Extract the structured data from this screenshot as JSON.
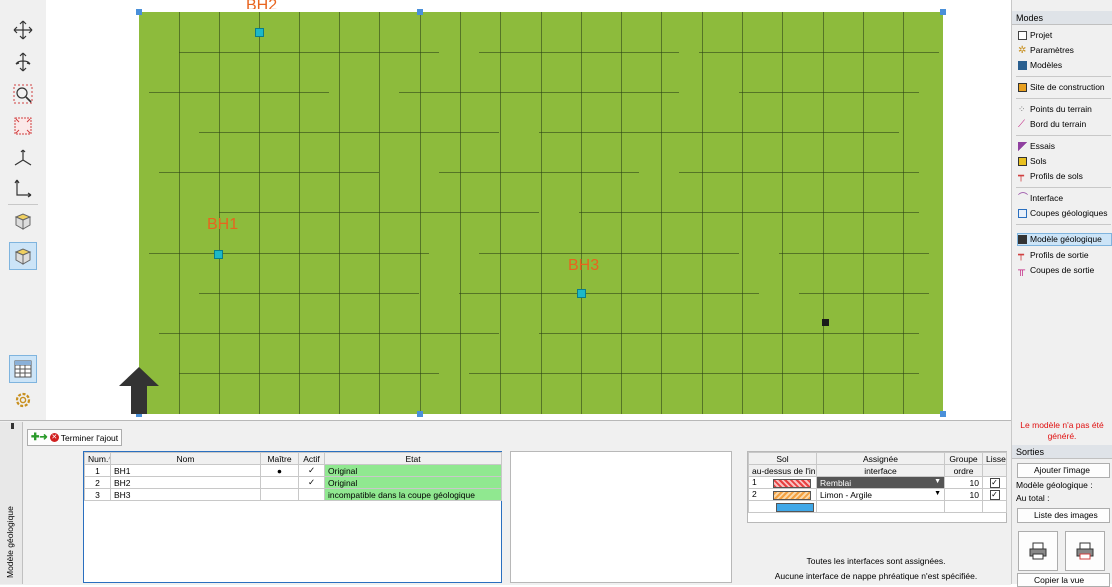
{
  "viewport": {
    "boreholes": [
      {
        "label": "BH1"
      },
      {
        "label": "BH3"
      },
      {
        "label": "BH2"
      }
    ]
  },
  "modes": {
    "title": "Modes",
    "items": [
      {
        "label": "Projet",
        "icon": "document-icon"
      },
      {
        "label": "Paramètres",
        "icon": "gear-icon"
      },
      {
        "label": "Modèles",
        "icon": "grid-icon"
      },
      {
        "label": "Site de construction",
        "icon": "site-icon"
      },
      {
        "label": "Points du terrain",
        "icon": "points-icon"
      },
      {
        "label": "Bord du terrain",
        "icon": "edge-icon"
      },
      {
        "label": "Essais",
        "icon": "test-icon"
      },
      {
        "label": "Sols",
        "icon": "soil-icon"
      },
      {
        "label": "Profils de sols",
        "icon": "soil-profile-icon"
      },
      {
        "label": "Interface",
        "icon": "interface-icon"
      },
      {
        "label": "Coupes géologiques",
        "icon": "geo-section-icon"
      },
      {
        "label": "Modèle géologique",
        "icon": "geo-model-icon"
      },
      {
        "label": "Profils de sortie",
        "icon": "output-profile-icon"
      },
      {
        "label": "Coupes de sortie",
        "icon": "output-section-icon"
      }
    ]
  },
  "warning": "Le modèle n'a pas été généré.",
  "outputs": {
    "title": "Sorties",
    "add_image": "Ajouter l'image",
    "model_label": "Modèle géologique :",
    "total_label": "Au total :",
    "list_images": "Liste des images",
    "copy_view": "Copier la vue"
  },
  "bottom": {
    "tab_label": "Modèle géologique",
    "finish_button": "Terminer l'ajout",
    "table": {
      "headers": [
        "Num.",
        "Nom",
        "Maître",
        "Actif",
        "Etat"
      ],
      "rows": [
        {
          "num": "1",
          "name": "BH1",
          "master": "●",
          "active": "✓",
          "state": "Original"
        },
        {
          "num": "2",
          "name": "BH2",
          "master": "",
          "active": "✓",
          "state": "Original"
        },
        {
          "num": "3",
          "name": "BH3",
          "master": "",
          "active": "",
          "state": "incompatible dans la coupe géologique"
        }
      ]
    },
    "soil_table": {
      "headers": [
        "Sol",
        "Assignée",
        "Groupe",
        "Lisser"
      ],
      "subheaders": [
        "au-dessus de l'in",
        "interface",
        "ordre",
        ""
      ],
      "rows": [
        {
          "num": "1",
          "soil": "Remblai",
          "order": "10",
          "pattern_color": "#e84040"
        },
        {
          "num": "2",
          "soil": "Limon - Argile",
          "order": "10",
          "pattern_color": "#f4a040"
        }
      ],
      "water_color": "#40a8e8"
    },
    "status1": "Toutes les interfaces sont assignées.",
    "status2": "Aucune interface de nappe phréatique n'est spécifiée."
  },
  "colors": {
    "terrain": "#8dbb3c",
    "accent": "#4a90d9",
    "warning": "#e01010"
  }
}
